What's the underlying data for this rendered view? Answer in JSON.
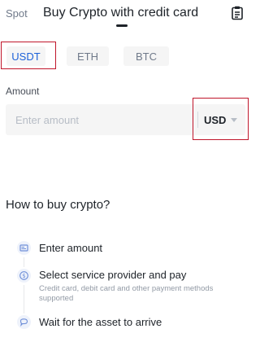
{
  "header": {
    "spot_label": "Spot",
    "title": "Buy Crypto with credit card"
  },
  "tabs": [
    {
      "label": "USDT",
      "active": true
    },
    {
      "label": "ETH",
      "active": false
    },
    {
      "label": "BTC",
      "active": false
    }
  ],
  "amount": {
    "label": "Amount",
    "placeholder": "Enter amount",
    "value": "",
    "currency": "USD"
  },
  "howto": {
    "title": "How to buy crypto?",
    "steps": [
      {
        "title": "Enter amount",
        "description": "",
        "icon": "card-icon"
      },
      {
        "title": "Select service provider and pay",
        "description": "Credit card, debit card and other payment methods supported",
        "icon": "dollar-icon"
      },
      {
        "title": "Wait for the asset to arrive",
        "description": "",
        "icon": "chat-icon"
      }
    ]
  },
  "colors": {
    "accent": "#1e62d9",
    "step_icon": "#6f8fd8",
    "highlight": "#c0162b"
  }
}
